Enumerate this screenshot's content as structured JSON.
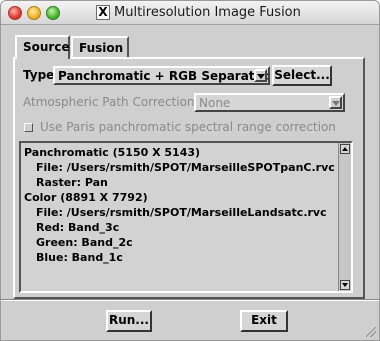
{
  "window": {
    "title": "Multiresolution Image Fusion",
    "x11_glyph": "X"
  },
  "tabs": [
    {
      "label": "Source"
    },
    {
      "label": "Fusion"
    }
  ],
  "source": {
    "type_label": "Type",
    "type_value": "Panchromatic + RGB Separated",
    "select_button": "Select...",
    "atm_label": "Atmospheric Path Correction",
    "atm_value": "None",
    "checkbox_label": "Use Paris panchromatic spectral range correction",
    "checkbox_checked": false,
    "info_lines": [
      {
        "text": "Panchromatic (5150 X 5143)",
        "indent": false
      },
      {
        "text": "File: /Users/rsmith/SPOT/MarseilleSPOTpanC.rvc",
        "indent": true
      },
      {
        "text": "Raster: Pan",
        "indent": true
      },
      {
        "text": "Color (8891 X 7792)",
        "indent": false
      },
      {
        "text": "File: /Users/rsmith/SPOT/MarseilleLandsatc.rvc",
        "indent": true
      },
      {
        "text": "Red: Band_3c",
        "indent": true
      },
      {
        "text": "Green: Band_2c",
        "indent": true
      },
      {
        "text": "Blue: Band_1c",
        "indent": true
      }
    ]
  },
  "buttons": {
    "run": "Run...",
    "exit": "Exit"
  }
}
